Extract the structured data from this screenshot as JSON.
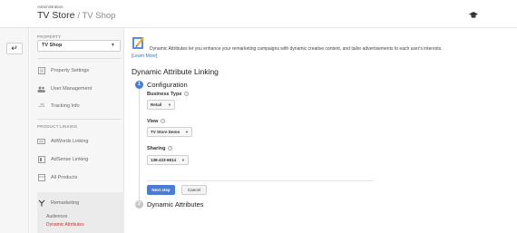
{
  "header": {
    "breadcrumb": "Administration",
    "title": "TV Store",
    "subtitle": "/ TV Shop",
    "icon": "graduation-cap-icon"
  },
  "sidebar": {
    "back_icon": "back-arrow-icon",
    "property_label": "PROPERTY",
    "property_value": "TV Shop",
    "items": [
      {
        "label": "Property Settings",
        "icon": "property-settings-icon"
      },
      {
        "label": "User Management",
        "icon": "users-icon"
      },
      {
        "label": "Tracking Info",
        "icon": "js-icon"
      }
    ],
    "product_linking_label": "PRODUCT LINKING",
    "product_items": [
      {
        "label": "AdWords Linking",
        "icon": "adwords-icon"
      },
      {
        "label": "AdSense Linking",
        "icon": "adsense-icon"
      },
      {
        "label": "All Products",
        "icon": "all-products-icon"
      }
    ],
    "remarketing": {
      "label": "Remarketing",
      "icon": "remarketing-icon",
      "sub_items": [
        {
          "label": "Audiences",
          "active": false
        },
        {
          "label": "Dynamic Attributes",
          "active": true
        }
      ]
    }
  },
  "main": {
    "intro_text": "Dynamic Attributes let you enhance your remarketing campaigns with dynamic creative content, and tailor advertisements to each user's interests.",
    "learn_more": "[Learn More]",
    "section_title": "Dynamic Attribute Linking",
    "steps": [
      {
        "number": "1",
        "title": "Configuration"
      },
      {
        "number": "2",
        "title": "Dynamic Attributes"
      }
    ],
    "fields": {
      "business_type": {
        "label": "Business Type",
        "value": "Retail"
      },
      "view": {
        "label": "View",
        "value": "TV Store Demo"
      },
      "sharing": {
        "label": "Sharing",
        "value": "138-433-6814"
      }
    },
    "next_label": "Next step",
    "cancel_label": "Cancel"
  },
  "colors": {
    "accent": "#4a7cd6",
    "active_link": "#c0392b"
  }
}
